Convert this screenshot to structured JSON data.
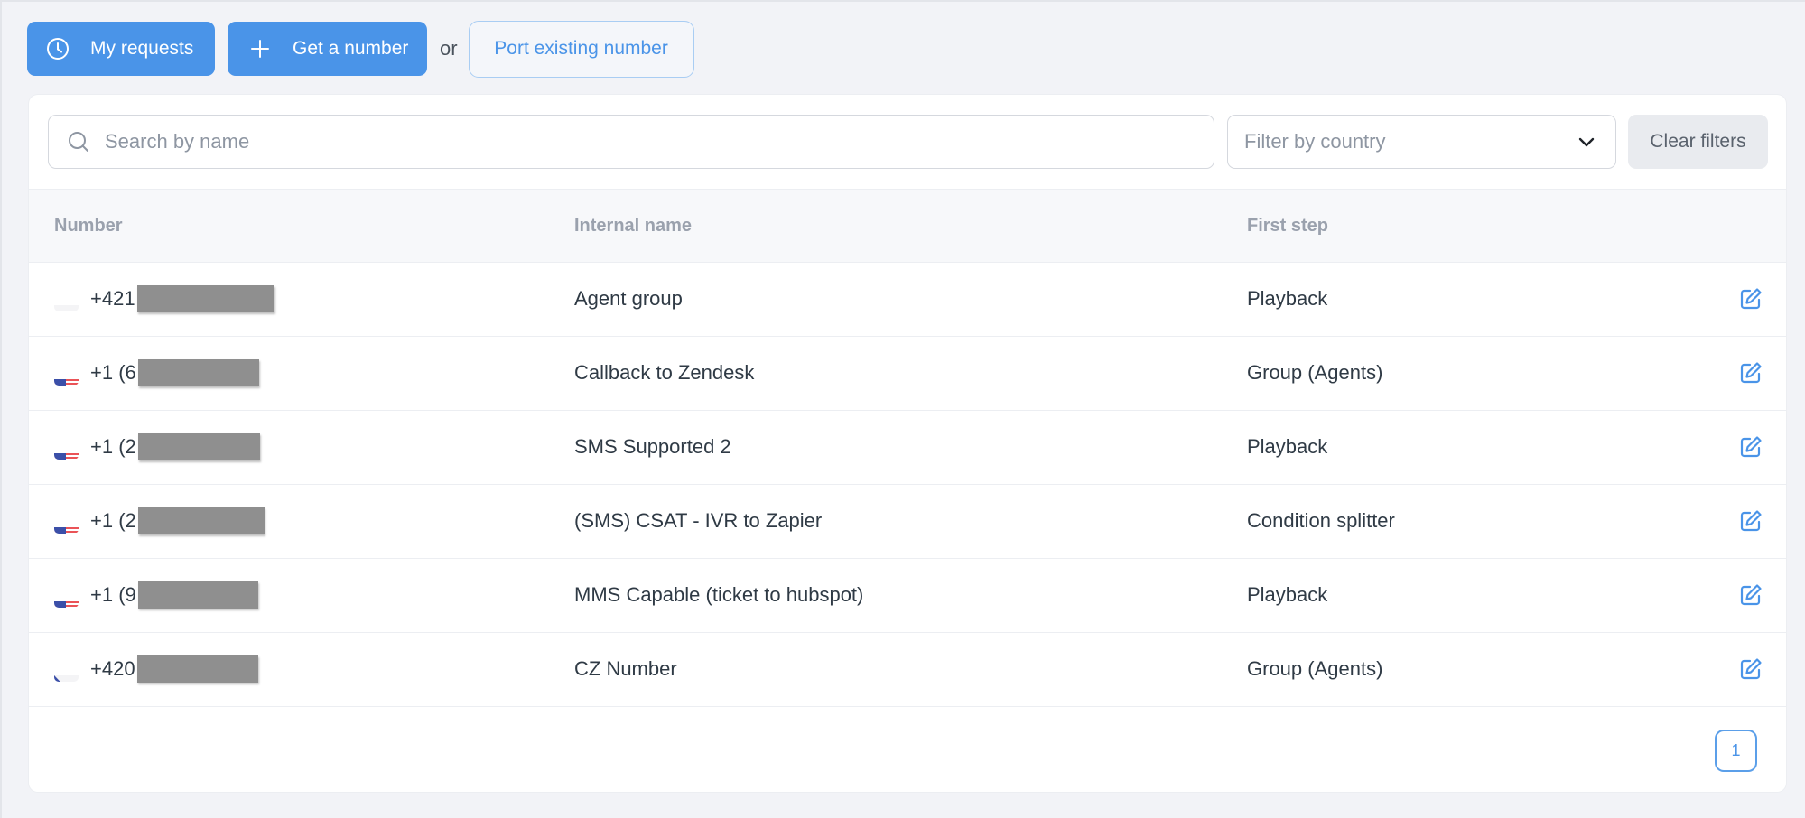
{
  "actions": {
    "my_requests": "My requests",
    "get_number": "Get a number",
    "or": "or",
    "port_existing": "Port existing number"
  },
  "filters": {
    "search_placeholder": "Search by name",
    "search_value": "",
    "country_placeholder": "Filter by country",
    "clear_label": "Clear filters"
  },
  "table": {
    "columns": [
      "Number",
      "Internal name",
      "First step"
    ],
    "rows": [
      {
        "flag": "sk",
        "number_prefix": "+421",
        "internal_name": "Agent group",
        "first_step": "Playback"
      },
      {
        "flag": "us",
        "number_prefix": "+1 (6",
        "internal_name": "Callback to Zendesk",
        "first_step": "Group (Agents)"
      },
      {
        "flag": "us",
        "number_prefix": "+1 (2",
        "internal_name": "SMS Supported 2",
        "first_step": "Playback"
      },
      {
        "flag": "us",
        "number_prefix": "+1 (2",
        "internal_name": "(SMS) CSAT - IVR to Zapier",
        "first_step": "Condition splitter"
      },
      {
        "flag": "us",
        "number_prefix": "+1 (9",
        "internal_name": "MMS Capable (ticket to hubspot)",
        "first_step": "Playback"
      },
      {
        "flag": "cz",
        "number_prefix": "+420",
        "internal_name": "CZ Number",
        "first_step": "Group (Agents)"
      }
    ]
  },
  "pagination": {
    "current_page": "1"
  },
  "colors": {
    "accent": "#4a94e8",
    "background": "#f2f3f7",
    "header_text": "#9aa1ad",
    "body_text": "#2f3a45"
  },
  "icons": {
    "my_requests": "clock-icon",
    "get_number": "plus-icon",
    "search": "search-icon",
    "country": "chevron-down-icon",
    "row_action": "edit-icon"
  }
}
